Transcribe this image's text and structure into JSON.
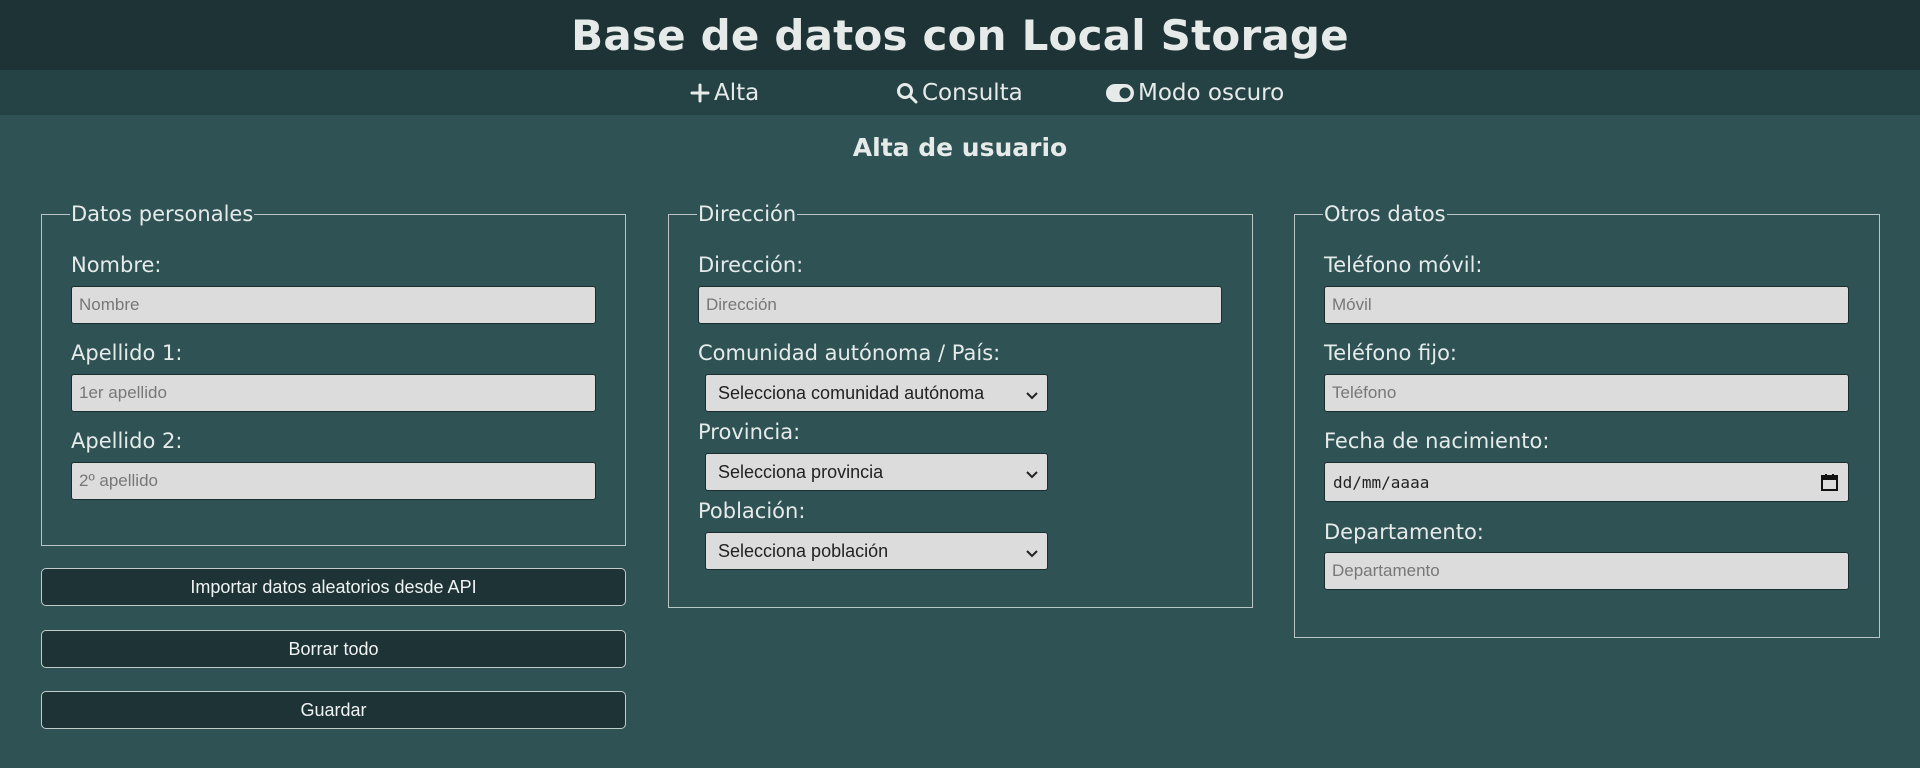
{
  "app": {
    "title": "Base de datos con Local Storage"
  },
  "nav": {
    "items": [
      {
        "label": "Alta",
        "icon": "plus-icon"
      },
      {
        "label": "Consulta",
        "icon": "search-icon"
      },
      {
        "label": "Modo oscuro",
        "icon": "toggle-icon"
      }
    ]
  },
  "page": {
    "title": "Alta de usuario"
  },
  "personal": {
    "legend": "Datos personales",
    "nombre_label": "Nombre:",
    "nombre_placeholder": "Nombre",
    "apellido1_label": "Apellido 1:",
    "apellido1_placeholder": "1er apellido",
    "apellido2_label": "Apellido 2:",
    "apellido2_placeholder": "2º apellido"
  },
  "address": {
    "legend": "Dirección",
    "direccion_label": "Dirección:",
    "direccion_placeholder": "Dirección",
    "comunidad_label": "Comunidad autónoma / País:",
    "comunidad_selected": "Selecciona comunidad autónoma",
    "provincia_label": "Provincia:",
    "provincia_selected": "Selecciona provincia",
    "poblacion_label": "Población:",
    "poblacion_selected": "Selecciona población"
  },
  "other": {
    "legend": "Otros datos",
    "movil_label": "Teléfono móvil:",
    "movil_placeholder": "Móvil",
    "fijo_label": "Teléfono fijo:",
    "fijo_placeholder": "Teléfono",
    "nacimiento_label": "Fecha de nacimiento:",
    "nacimiento_format": "dd/mm/aaaa",
    "departamento_label": "Departamento:",
    "departamento_placeholder": "Departamento"
  },
  "actions": {
    "import_label": "Importar datos aleatorios desde API",
    "clear_label": "Borrar todo",
    "save_label": "Guardar"
  },
  "colors": {
    "background": "#2f5254",
    "header": "#1e3335",
    "nav": "#254244",
    "input": "#dcdcdc"
  }
}
